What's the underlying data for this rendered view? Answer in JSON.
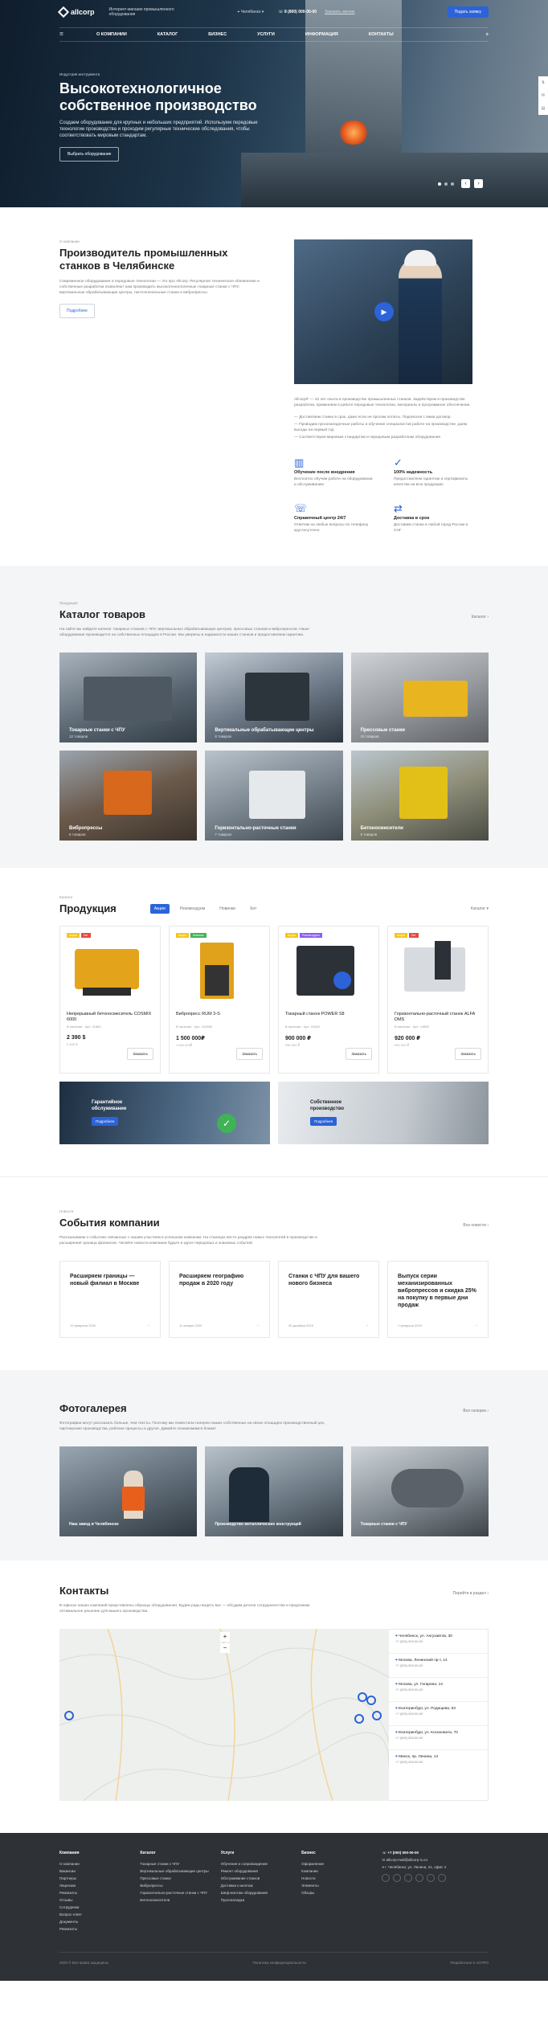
{
  "header": {
    "logo": "allcorp",
    "tagline": "Интернет-магазин промышленного оборудования",
    "city": "Челябинск",
    "phone": "8 (800) 000-00-00",
    "callback": "Заказать звонок",
    "cta": "Подать заявку",
    "nav": [
      "О компании",
      "Каталог",
      "Бизнес",
      "Услуги",
      "Информация",
      "Контакты"
    ]
  },
  "hero": {
    "eyebrow": "Индустрия инструмента",
    "title": "Высокотехнологичное собственное производство",
    "text": "Создаем оборудование для крупных и небольших предприятий. Используем передовые технологии производства и проходим регулярные технические обследования, чтобы соответствовать мировым стандартам.",
    "button": "Выбрать оборудование"
  },
  "about": {
    "label": "О компании",
    "title": "Производитель промышленных станков в Челябинске",
    "text": "Современное оборудование и передовые технологии — это про Allcorp. Регулярное техническое обновление и собственные разработки позволяют нам производить высокотехнологичные токарные станки с ЧПУ, вертикальные обрабатывающие центры, ленточнопильные станки и вибропрессы.",
    "button": "Подробнее",
    "desc": "Allcorp® — 10 лет опыта в производстве промышленных станков. Задействуем в производстве разработки, применяем в работе передовые технологии, материалы и программное обеспечение.",
    "bullets": [
      "— Доставляем станки в срок, даже если не просим оплаты. Подписали с вами договор.",
      "— Проводим пусконаладочные работы и обучение специалистов работе на производстве, даем выгоды на первый год",
      "— Соответствуем мировым стандартам и передовым разработкам оборудования"
    ],
    "features": [
      {
        "icon": "▥",
        "title": "Обучение после внедрения",
        "text": "Бесплатно обучим работе на оборудовании и обслуживанию"
      },
      {
        "icon": "✓",
        "title": "100% надежность",
        "text": "Предоставляем гарантию и сертификаты качества на всю продукцию"
      },
      {
        "icon": "☏",
        "title": "Справочный центр 24/7",
        "text": "Ответим на любые вопросы по телефону круглосуточно"
      },
      {
        "icon": "⇄",
        "title": "Доставка в срок",
        "text": "Доставим станки в любой город России и СНГ"
      }
    ]
  },
  "catalog": {
    "label": "Продукция",
    "title": "Каталог товаров",
    "more": "Каталог",
    "text": "На сайте вы найдете каталог токарных станков с ЧПУ, вертикальных обрабатывающих центров, прессовых станков и вибропрессов. Наше оборудование производится на собственных площадях в России. Мы уверены в надежности наших станков и предоставляем гарантию.",
    "items": [
      {
        "title": "Токарные станки с ЧПУ",
        "count": "12 товаров"
      },
      {
        "title": "Вертикальные обрабатывающие центры",
        "count": "8 товаров"
      },
      {
        "title": "Прессовые станки",
        "count": "10 товаров"
      },
      {
        "title": "Вибропрессы",
        "count": "6 товаров"
      },
      {
        "title": "Горизонтально-расточные станки",
        "count": "7 товаров"
      },
      {
        "title": "Бетоносмесители",
        "count": "5 товаров"
      }
    ]
  },
  "products": {
    "label": "Каталог",
    "title": "Продукция",
    "tabs": [
      "Акции",
      "Рекомендуем",
      "Новинки",
      "Хит"
    ],
    "more": "Каталог",
    "items": [
      {
        "name": "Непрерывный бетоносмеситель COSMIX 6000",
        "meta": "В наличии · Арт: 11560",
        "price": "2 390 $",
        "old": "2 690 $",
        "buy": "Заказать"
      },
      {
        "name": "Вибропресс RUM 3-S",
        "meta": "В наличии · Арт: 102890",
        "price": "1 500 000₽",
        "old": "1 650 000₽",
        "buy": "Заказать"
      },
      {
        "name": "Токарный станок POWER S8",
        "meta": "В наличии · Арт: 22440",
        "price": "900 000 ₽",
        "old": "990 000 ₽",
        "buy": "Заказать"
      },
      {
        "name": "Горизонтально-расточный станок ALFA DMS",
        "meta": "В наличии · Арт: 13890",
        "price": "920 000 ₽",
        "old": "990 000 ₽",
        "buy": "Заказать"
      }
    ],
    "promo": [
      {
        "title": "Гарантийное обслуживание",
        "button": "Подробнее"
      },
      {
        "title": "Собственное производство",
        "button": "Подробнее"
      }
    ]
  },
  "news": {
    "label": "Новости",
    "title": "События компании",
    "more": "Все новости",
    "text": "Рассказываем о событиях связанных с нашим участием в успешном компании. На станицах вестн раздрев новых технологий в производстве и расширения граница филиалов. Читайте новости компании будьте в курсе передовых и знакомых событий.",
    "items": [
      {
        "title": "Расширяем границы — новый филиал в Москве",
        "date": "10 февраля 2020"
      },
      {
        "title": "Расширяем географию продаж в 2020 году",
        "date": "11 января 2020"
      },
      {
        "title": "Станки с ЧПУ для вашего нового бизнеса",
        "date": "30 декабря 2019"
      },
      {
        "title": "Выпуск серии механизированных вибропрессов и скидка 25% на покупку в первые дни продаж",
        "date": "1 февраля 2020"
      }
    ]
  },
  "gallery": {
    "title": "Фотогалерея",
    "more": "Все галереи",
    "text": "Фотографии могут рассказать больше, чем тексты. Поэтому мы поместили галереи наших собственных на своих площадях производственный цех, партнерские производства, рабочие процессы и другое. Давайте познакомимся ближе!",
    "items": [
      "Наш завод в Челябинске",
      "Производство металлических конструкций",
      "Токарные станки с ЧПУ"
    ]
  },
  "contacts": {
    "title": "Контакты",
    "more": "Перейти в раздел",
    "text": "В офисах наших компаний представлены образцы оборудования. Будем рады видеть вас — обсудим детали сотрудничества и предложим оптимальное решение для вашего производства.",
    "offices": [
      {
        "addr": "Челябинск, ул. Ангузавтов, 30",
        "phone": "+7 (000) 000-00-00"
      },
      {
        "addr": "Москва, Ленинский пр-т, 14",
        "phone": "+7 (000) 000-00-00"
      },
      {
        "addr": "Москва, ул. Гагарина, 14",
        "phone": "+7 (000) 000-00-00"
      },
      {
        "addr": "Екатеринбург, ул. Родищева, 63",
        "phone": "+7 (000) 000-00-00"
      },
      {
        "addr": "Екатеринбург, ул. Косиновата, 70",
        "phone": "+7 (000) 000-00-00"
      },
      {
        "addr": "Минск, пр. Ленина, 14",
        "phone": "+7 (000) 000-00-00"
      }
    ]
  },
  "footer": {
    "cols": [
      {
        "title": "Компания",
        "items": [
          "О компании",
          "Вакансии",
          "Партнеры",
          "Лицензии",
          "Реквизиты",
          "Отзывы",
          "Сотрудники",
          "Вопрос-ответ",
          "Документы",
          "Реквизиты"
        ]
      },
      {
        "title": "Каталог",
        "items": [
          "Токарные станки с ЧПУ",
          "Вертикальные обрабатывающие центры",
          "Прессовые станки",
          "Вибропрессы",
          "Горизонтально-расточные станки с ЧПУ",
          "Бетоносмесители"
        ]
      },
      {
        "title": "Услуги",
        "items": [
          "Обучение и сопровождение",
          "Ремонт оборудования",
          "Обслуживание станков",
          "Доставка и монтаж",
          "Шеф-монтаж оборудования",
          "Пусконаладка"
        ]
      },
      {
        "title": "Бизнес",
        "items": [
          "Оформление",
          "Компании",
          "Новости",
          "Элементы",
          "Обзоры"
        ]
      }
    ],
    "phone": "+7 (000) 000-00-00",
    "email": "allcorp-mail@allcorp-ru.ru",
    "address": "г. Челябинск, ул. Ленина, 21, офис 4",
    "copyright": "2020 © Все права защищены",
    "policy": "Политика конфиденциальности",
    "dev": "Разработано в АСПРО"
  },
  "colors": {
    "accent": "#2c63d8",
    "dark": "#2e3135",
    "sale": "#f4c51d",
    "hit": "#e44b3b",
    "new": "#3fb356"
  }
}
